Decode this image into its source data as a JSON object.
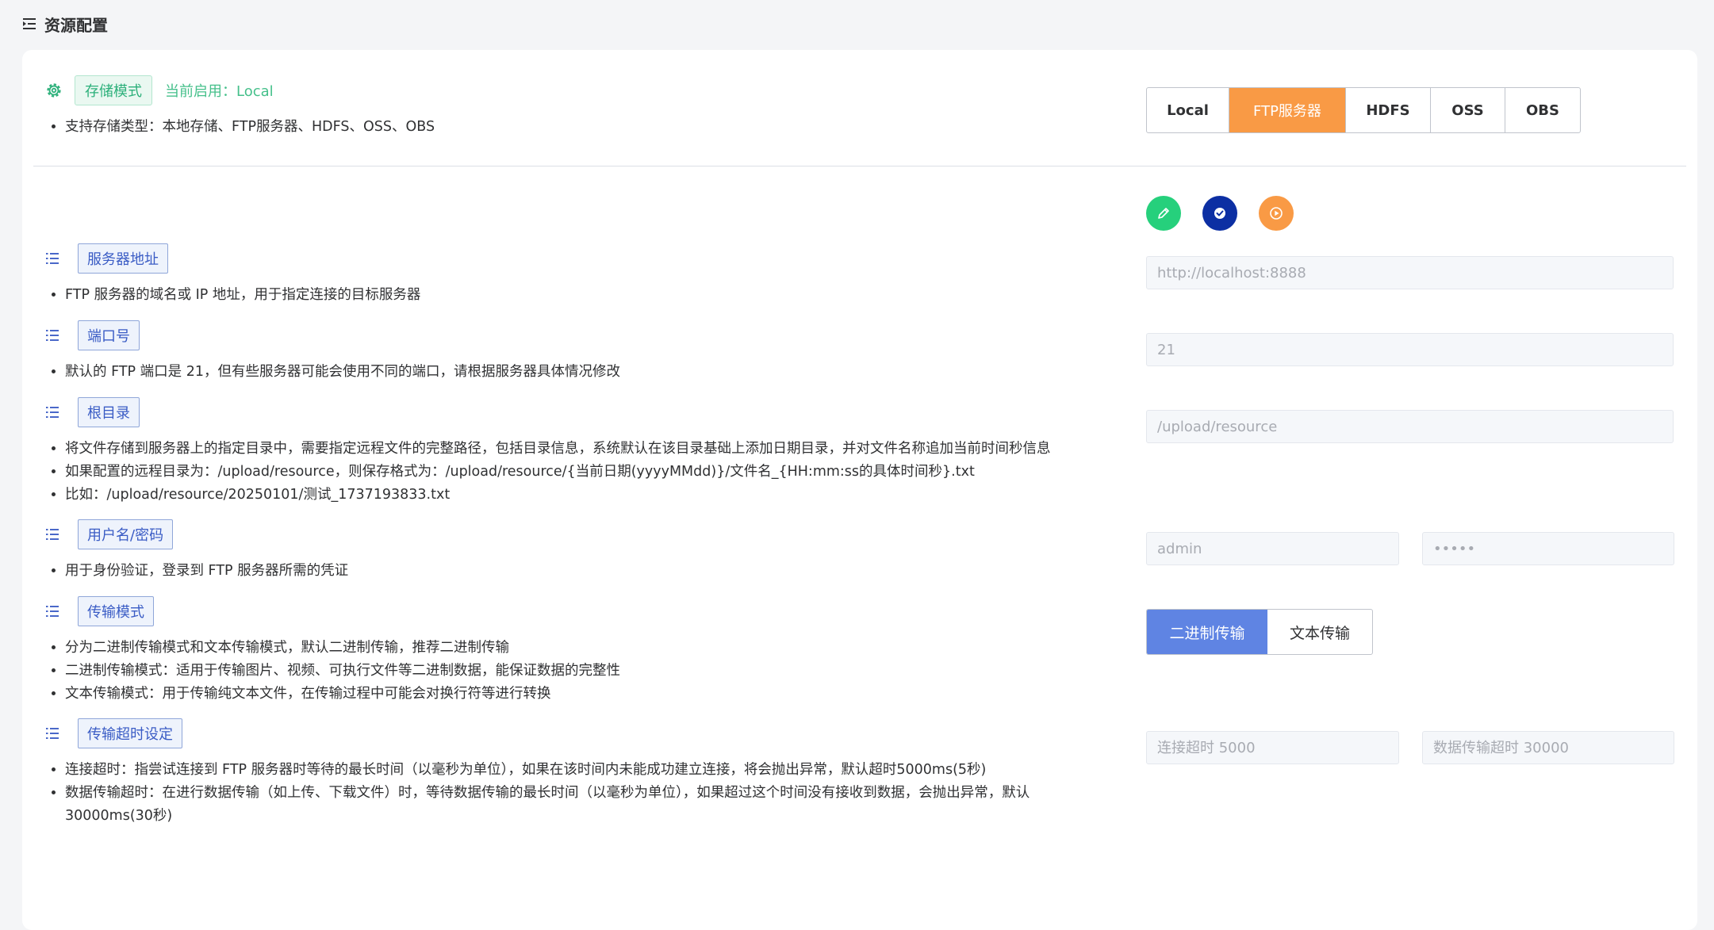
{
  "page": {
    "title": "资源配置"
  },
  "storage": {
    "tag": "存储模式",
    "current": "当前启用：Local",
    "desc": "支持存储类型：本地存储、FTP服务器、HDFS、OSS、OBS",
    "options": [
      "Local",
      "FTP服务器",
      "HDFS",
      "OSS",
      "OBS"
    ],
    "active": "FTP服务器"
  },
  "actions": {
    "edit_icon": "pencil-icon",
    "confirm_icon": "check-circle-icon",
    "test_icon": "play-circle-icon",
    "colors": {
      "edit": "#26d07c",
      "confirm": "#0c2fa3",
      "test": "#f99a45"
    }
  },
  "sections": {
    "server": {
      "tag": "服务器地址",
      "lines": [
        "FTP 服务器的域名或 IP 地址，用于指定连接的目标服务器"
      ],
      "placeholder": "http://localhost:8888"
    },
    "port": {
      "tag": "端口号",
      "lines": [
        "默认的 FTP 端口是 21，但有些服务器可能会使用不同的端口，请根据服务器具体情况修改"
      ],
      "placeholder": "21"
    },
    "root": {
      "tag": "根目录",
      "lines": [
        "将文件存储到服务器上的指定目录中，需要指定远程文件的完整路径，包括目录信息，系统默认在该目录基础上添加日期目录，并对文件名称追加当前时间秒信息",
        "如果配置的远程目录为：/upload/resource，则保存格式为：/upload/resource/{当前日期(yyyyMMdd)}/文件名_{HH:mm:ss的具体时间秒}.txt",
        "比如：/upload/resource/20250101/测试_1737193833.txt"
      ],
      "placeholder": "/upload/resource"
    },
    "auth": {
      "tag": "用户名/密码",
      "lines": [
        "用于身份验证，登录到 FTP 服务器所需的凭证"
      ],
      "username_placeholder": "admin",
      "password_value": "•••••"
    },
    "mode": {
      "tag": "传输模式",
      "lines": [
        "分为二进制传输模式和文本传输模式，默认二进制传输，推荐二进制传输",
        "二进制传输模式：适用于传输图片、视频、可执行文件等二进制数据，能保证数据的完整性",
        "文本传输模式：用于传输纯文本文件，在传输过程中可能会对换行符等进行转换"
      ],
      "options": [
        "二进制传输",
        "文本传输"
      ],
      "active": "二进制传输"
    },
    "timeout": {
      "tag": "传输超时设定",
      "lines": [
        "连接超时：指尝试连接到 FTP 服务器时等待的最长时间（以毫秒为单位），如果在该时间内未能成功建立连接，将会抛出异常，默认超时5000ms(5秒)",
        "数据传输超时：在进行数据传输（如上传、下载文件）时，等待数据传输的最长时间（以毫秒为单位），如果超过这个时间没有接收到数据，会抛出异常，默认30000ms(30秒)"
      ],
      "connect_placeholder": "连接超时 5000",
      "data_placeholder": "数据传输超时 30000"
    }
  }
}
